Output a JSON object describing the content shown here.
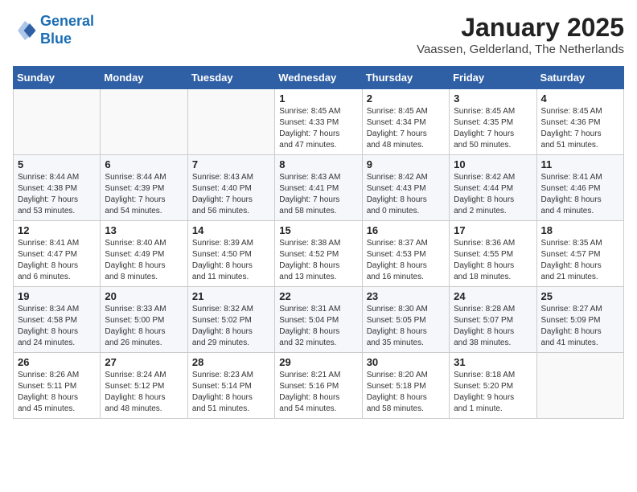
{
  "header": {
    "logo_line1": "General",
    "logo_line2": "Blue",
    "month": "January 2025",
    "location": "Vaassen, Gelderland, The Netherlands"
  },
  "weekdays": [
    "Sunday",
    "Monday",
    "Tuesday",
    "Wednesday",
    "Thursday",
    "Friday",
    "Saturday"
  ],
  "weeks": [
    [
      {
        "day": "",
        "info": ""
      },
      {
        "day": "",
        "info": ""
      },
      {
        "day": "",
        "info": ""
      },
      {
        "day": "1",
        "info": "Sunrise: 8:45 AM\nSunset: 4:33 PM\nDaylight: 7 hours\nand 47 minutes."
      },
      {
        "day": "2",
        "info": "Sunrise: 8:45 AM\nSunset: 4:34 PM\nDaylight: 7 hours\nand 48 minutes."
      },
      {
        "day": "3",
        "info": "Sunrise: 8:45 AM\nSunset: 4:35 PM\nDaylight: 7 hours\nand 50 minutes."
      },
      {
        "day": "4",
        "info": "Sunrise: 8:45 AM\nSunset: 4:36 PM\nDaylight: 7 hours\nand 51 minutes."
      }
    ],
    [
      {
        "day": "5",
        "info": "Sunrise: 8:44 AM\nSunset: 4:38 PM\nDaylight: 7 hours\nand 53 minutes."
      },
      {
        "day": "6",
        "info": "Sunrise: 8:44 AM\nSunset: 4:39 PM\nDaylight: 7 hours\nand 54 minutes."
      },
      {
        "day": "7",
        "info": "Sunrise: 8:43 AM\nSunset: 4:40 PM\nDaylight: 7 hours\nand 56 minutes."
      },
      {
        "day": "8",
        "info": "Sunrise: 8:43 AM\nSunset: 4:41 PM\nDaylight: 7 hours\nand 58 minutes."
      },
      {
        "day": "9",
        "info": "Sunrise: 8:42 AM\nSunset: 4:43 PM\nDaylight: 8 hours\nand 0 minutes."
      },
      {
        "day": "10",
        "info": "Sunrise: 8:42 AM\nSunset: 4:44 PM\nDaylight: 8 hours\nand 2 minutes."
      },
      {
        "day": "11",
        "info": "Sunrise: 8:41 AM\nSunset: 4:46 PM\nDaylight: 8 hours\nand 4 minutes."
      }
    ],
    [
      {
        "day": "12",
        "info": "Sunrise: 8:41 AM\nSunset: 4:47 PM\nDaylight: 8 hours\nand 6 minutes."
      },
      {
        "day": "13",
        "info": "Sunrise: 8:40 AM\nSunset: 4:49 PM\nDaylight: 8 hours\nand 8 minutes."
      },
      {
        "day": "14",
        "info": "Sunrise: 8:39 AM\nSunset: 4:50 PM\nDaylight: 8 hours\nand 11 minutes."
      },
      {
        "day": "15",
        "info": "Sunrise: 8:38 AM\nSunset: 4:52 PM\nDaylight: 8 hours\nand 13 minutes."
      },
      {
        "day": "16",
        "info": "Sunrise: 8:37 AM\nSunset: 4:53 PM\nDaylight: 8 hours\nand 16 minutes."
      },
      {
        "day": "17",
        "info": "Sunrise: 8:36 AM\nSunset: 4:55 PM\nDaylight: 8 hours\nand 18 minutes."
      },
      {
        "day": "18",
        "info": "Sunrise: 8:35 AM\nSunset: 4:57 PM\nDaylight: 8 hours\nand 21 minutes."
      }
    ],
    [
      {
        "day": "19",
        "info": "Sunrise: 8:34 AM\nSunset: 4:58 PM\nDaylight: 8 hours\nand 24 minutes."
      },
      {
        "day": "20",
        "info": "Sunrise: 8:33 AM\nSunset: 5:00 PM\nDaylight: 8 hours\nand 26 minutes."
      },
      {
        "day": "21",
        "info": "Sunrise: 8:32 AM\nSunset: 5:02 PM\nDaylight: 8 hours\nand 29 minutes."
      },
      {
        "day": "22",
        "info": "Sunrise: 8:31 AM\nSunset: 5:04 PM\nDaylight: 8 hours\nand 32 minutes."
      },
      {
        "day": "23",
        "info": "Sunrise: 8:30 AM\nSunset: 5:05 PM\nDaylight: 8 hours\nand 35 minutes."
      },
      {
        "day": "24",
        "info": "Sunrise: 8:28 AM\nSunset: 5:07 PM\nDaylight: 8 hours\nand 38 minutes."
      },
      {
        "day": "25",
        "info": "Sunrise: 8:27 AM\nSunset: 5:09 PM\nDaylight: 8 hours\nand 41 minutes."
      }
    ],
    [
      {
        "day": "26",
        "info": "Sunrise: 8:26 AM\nSunset: 5:11 PM\nDaylight: 8 hours\nand 45 minutes."
      },
      {
        "day": "27",
        "info": "Sunrise: 8:24 AM\nSunset: 5:12 PM\nDaylight: 8 hours\nand 48 minutes."
      },
      {
        "day": "28",
        "info": "Sunrise: 8:23 AM\nSunset: 5:14 PM\nDaylight: 8 hours\nand 51 minutes."
      },
      {
        "day": "29",
        "info": "Sunrise: 8:21 AM\nSunset: 5:16 PM\nDaylight: 8 hours\nand 54 minutes."
      },
      {
        "day": "30",
        "info": "Sunrise: 8:20 AM\nSunset: 5:18 PM\nDaylight: 8 hours\nand 58 minutes."
      },
      {
        "day": "31",
        "info": "Sunrise: 8:18 AM\nSunset: 5:20 PM\nDaylight: 9 hours\nand 1 minute."
      },
      {
        "day": "",
        "info": ""
      }
    ]
  ]
}
